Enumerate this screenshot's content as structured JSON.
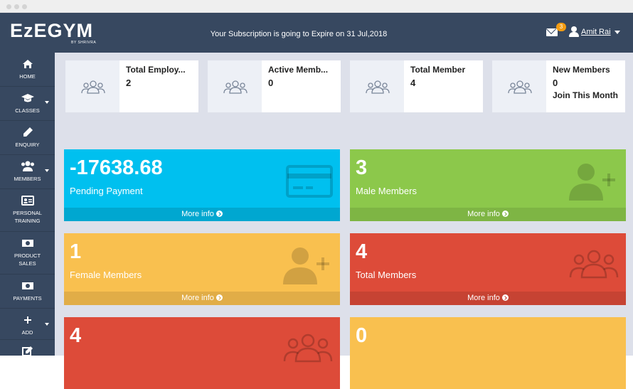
{
  "header": {
    "logo_text": "EzEGYM",
    "logo_sub": "BY SHRIVRA",
    "subscription_notice": "Your Subscription is going to Expire on 31 Jul,2018",
    "mail_badge_count": "3",
    "user_name": "Amit Rai"
  },
  "sidebar": {
    "items": [
      {
        "label": "HOME",
        "icon": "home-icon"
      },
      {
        "label": "CLASSES",
        "icon": "graduation-cap-icon"
      },
      {
        "label": "ENQUIRY",
        "icon": "pencil-icon"
      },
      {
        "label": "MEMBERS",
        "icon": "users-icon"
      },
      {
        "label_line1": "PERSONAL",
        "label_line2": "TRAINING",
        "icon": "id-card-icon"
      },
      {
        "label_line1": "PRODUCT",
        "label_line2": "SALES",
        "icon": "money-icon"
      },
      {
        "label": "PAYMENTS",
        "icon": "money-icon"
      },
      {
        "label": "ADD",
        "icon": "plus-icon"
      },
      {
        "label": "",
        "icon": "edit-icon"
      }
    ]
  },
  "stats": [
    {
      "label": "Total Employ...",
      "value": "2"
    },
    {
      "label": "Active Memb...",
      "value": "0"
    },
    {
      "label": "Total Member",
      "value": "4"
    },
    {
      "label": "New Members",
      "value": "0",
      "sub": "Join This Month"
    }
  ],
  "boxes": [
    {
      "value": "-17638.68",
      "label": "Pending Payment",
      "footer": "More info",
      "color": "#00c0ef",
      "icon": "credit-card-icon"
    },
    {
      "value": "3",
      "label": "Male Members",
      "footer": "More info",
      "color": "#8cc84b",
      "icon": "user-plus-icon"
    },
    {
      "value": "1",
      "label": "Female Members",
      "footer": "More info",
      "color": "#f9c04f",
      "icon": "user-plus-icon"
    },
    {
      "value": "4",
      "label": "Total Members",
      "footer": "More info",
      "color": "#dd4b39",
      "icon": "users-icon"
    },
    {
      "value": "4",
      "label": "",
      "footer": "",
      "color": "#dd4b39",
      "icon": "users-icon"
    },
    {
      "value": "0",
      "label": "",
      "footer": "",
      "color": "#f9c04f",
      "icon": ""
    }
  ]
}
